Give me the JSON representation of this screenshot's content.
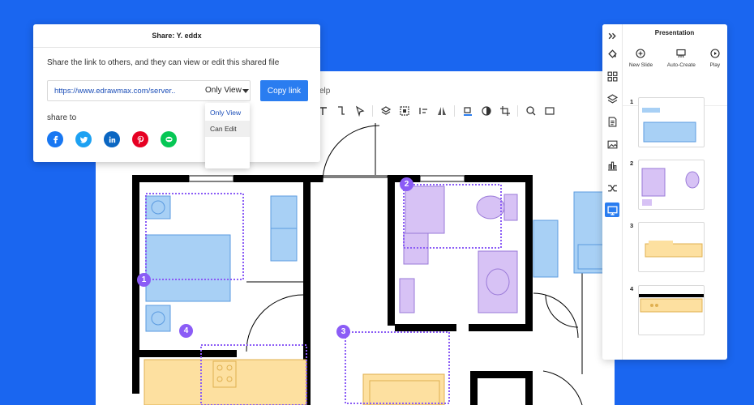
{
  "app": {
    "menu_fragment": "elp"
  },
  "toolbar": {
    "icons": [
      "text-icon",
      "connector-icon",
      "pointer-icon",
      "layers-icon",
      "group-icon",
      "arrange-icon",
      "flip-icon",
      "fill-icon",
      "style-icon",
      "crop-icon",
      "search-icon",
      "fullscreen-icon"
    ]
  },
  "markers": {
    "m1": "1",
    "m2": "2",
    "m3": "3",
    "m4": "4"
  },
  "share_dialog": {
    "title": "Share: Y. eddx",
    "description": "Share the link to others, and they can view or edit this shared file",
    "link_value": "https://www.edrawmax.com/server..",
    "permission_selected": "Only View",
    "copy_button": "Copy link",
    "permission_options": [
      "Only View",
      "Can Edit"
    ],
    "share_to_label": "share to",
    "socials": [
      {
        "name": "facebook",
        "color": "#1877f2"
      },
      {
        "name": "twitter",
        "color": "#1da1f2"
      },
      {
        "name": "linkedin",
        "color": "#0a66c2"
      },
      {
        "name": "pinterest",
        "color": "#e60023"
      },
      {
        "name": "line",
        "color": "#06c755"
      }
    ]
  },
  "presentation": {
    "title": "Presentation",
    "actions": {
      "new_slide": "New Slide",
      "auto_create": "Auto-Create",
      "play": "Play"
    },
    "slides": [
      "1",
      "2",
      "3",
      "4"
    ]
  },
  "colors": {
    "background": "#1a66f0",
    "accent": "#2a7df0",
    "furniture_blue": "#a8d0f5",
    "furniture_purple": "#d7c2f5",
    "furniture_yellow": "#fde0a0",
    "marker": "#8b5cf6"
  }
}
